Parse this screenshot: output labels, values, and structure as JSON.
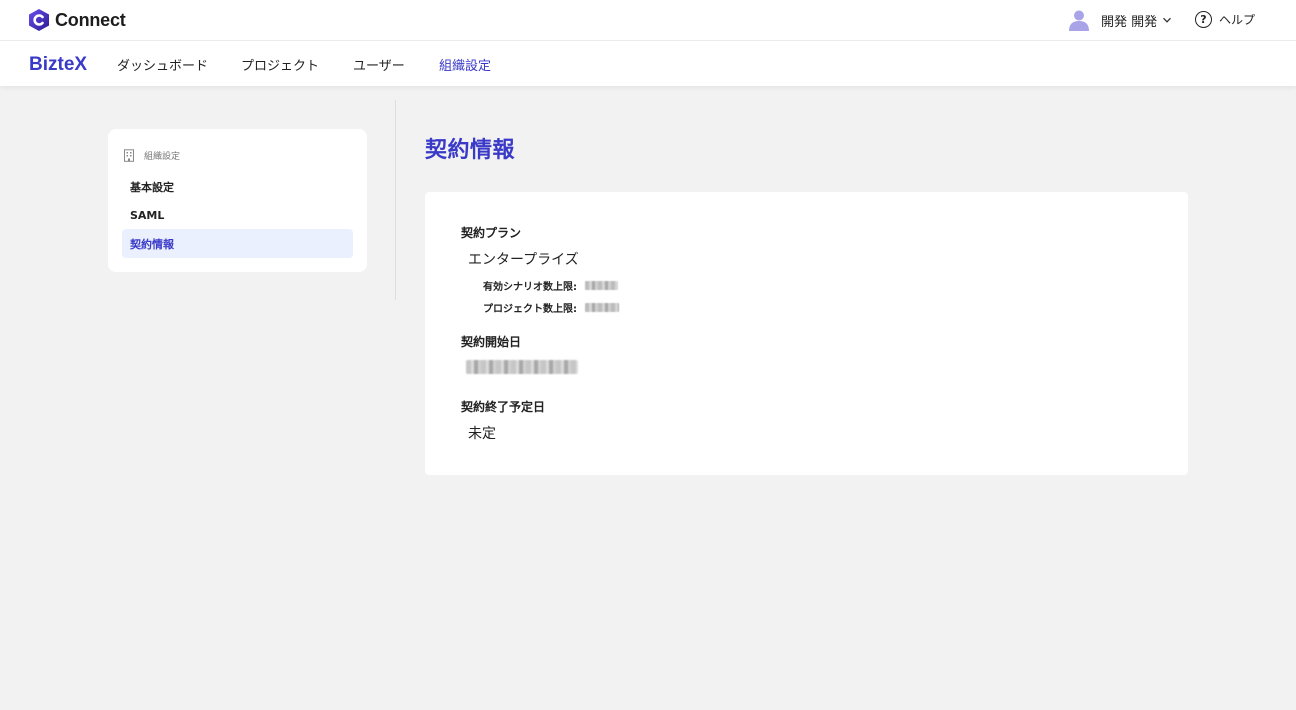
{
  "app": {
    "logo_text": "Connect",
    "brand": "BizteX",
    "accent": "#3a3ac8"
  },
  "header": {
    "user_name": "開発 開発",
    "help_label": "ヘルプ"
  },
  "nav": {
    "items": [
      {
        "label": "ダッシュボード",
        "active": false
      },
      {
        "label": "プロジェクト",
        "active": false
      },
      {
        "label": "ユーザー",
        "active": false
      },
      {
        "label": "組織設定",
        "active": true
      }
    ]
  },
  "sidebar": {
    "header": "組織設定",
    "items": [
      {
        "label": "基本設定",
        "active": false
      },
      {
        "label": "SAML",
        "active": false
      },
      {
        "label": "契約情報",
        "active": true
      }
    ]
  },
  "main": {
    "title": "契約情報",
    "plan_label": "契約プラン",
    "plan_value": "エンタープライズ",
    "scenario_limit_label": "有効シナリオ数上限:",
    "project_limit_label": "プロジェクト数上限:",
    "start_label": "契約開始日",
    "end_label": "契約終了予定日",
    "end_value": "未定"
  }
}
